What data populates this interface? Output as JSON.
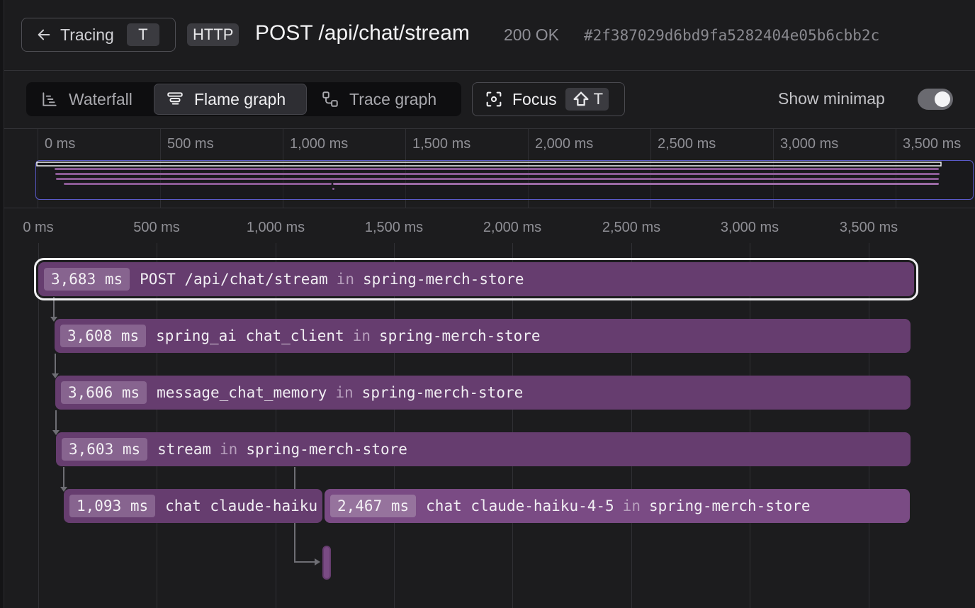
{
  "header": {
    "back_label": "Tracing",
    "back_shortcut": "T",
    "protocol_badge": "HTTP",
    "title": "POST /api/chat/stream",
    "status": "200 OK",
    "trace_id": "#2f387029d6bd9fa5282404e05b6cbb2c"
  },
  "toolbar": {
    "views": [
      {
        "label": "Waterfall",
        "icon": "waterfall-icon",
        "active": false
      },
      {
        "label": "Flame graph",
        "icon": "flame-graph-icon",
        "active": true
      },
      {
        "label": "Trace graph",
        "icon": "trace-graph-icon",
        "active": false
      }
    ],
    "focus_label": "Focus",
    "focus_shortcut_key": "T",
    "focus_shortcut_modifier": "shift-icon",
    "minimap_label": "Show minimap",
    "minimap_enabled": true
  },
  "minimap": {
    "tick_labels": [
      "0 ms",
      "500 ms",
      "1,000 ms",
      "1,500 ms",
      "2,000 ms",
      "2,500 ms",
      "3,000 ms",
      "3,500 ms"
    ]
  },
  "flame": {
    "tick_labels": [
      "0 ms",
      "500 ms",
      "1,000 ms",
      "1,500 ms",
      "2,000 ms",
      "2,500 ms",
      "3,000 ms",
      "3,500 ms"
    ],
    "joiner": "in",
    "spans": [
      {
        "duration": "3,683 ms",
        "name": "POST /api/chat/stream",
        "service": "spring-merch-store",
        "selected": true
      },
      {
        "duration": "3,608 ms",
        "name": "spring_ai chat_client",
        "service": "spring-merch-store"
      },
      {
        "duration": "3,606 ms",
        "name": "message_chat_memory",
        "service": "spring-merch-store"
      },
      {
        "duration": "3,603 ms",
        "name": "stream",
        "service": "spring-merch-store"
      },
      {
        "duration": "1,093 ms",
        "name": "chat claude-haiku",
        "service": ""
      },
      {
        "duration": "2,467 ms",
        "name": "chat claude-haiku-4-5",
        "service": "spring-merch-store"
      }
    ]
  },
  "colors": {
    "span": "#663d6f",
    "span_alt": "#7a4b84",
    "minimap_window": "#5a5ac8"
  }
}
